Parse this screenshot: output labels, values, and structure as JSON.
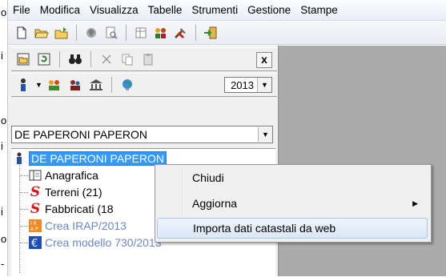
{
  "left_edge_chars": [
    "o",
    "i",
    "o",
    "i",
    "i",
    "o",
    "-"
  ],
  "menu": [
    "File",
    "Modifica",
    "Visualizza",
    "Tabelle",
    "Strumenti",
    "Gestione",
    "Stampe"
  ],
  "toolbar": {
    "icons": [
      "new-document-icon",
      "open-folder-icon",
      "open-file-icon",
      "circle-icon",
      "print-preview-icon",
      "columns-icon",
      "people-icon",
      "tools-icon",
      "exit-icon"
    ]
  },
  "panel": {
    "close_label": "x",
    "year": "2013",
    "taxpayer": "DE PAPERONI PAPERON"
  },
  "tree": {
    "root": "DE PAPERONI PAPERON",
    "children": [
      {
        "label": "Anagrafica",
        "color": "#000000"
      },
      {
        "label": "Terreni (21)",
        "color": "#000000"
      },
      {
        "label": "Fabbricati (18",
        "color": "#000000"
      },
      {
        "label": "Crea IRAP/2013",
        "color": "#6b86c9"
      },
      {
        "label": "Crea modello 730/2013",
        "color": "#6b86c9"
      }
    ]
  },
  "context_menu": {
    "items": [
      {
        "label": "Chiudi"
      },
      {
        "label": "Aggiorna",
        "submenu_arrow": "▶"
      },
      {
        "label": "Importa dati catastali da web"
      }
    ]
  }
}
